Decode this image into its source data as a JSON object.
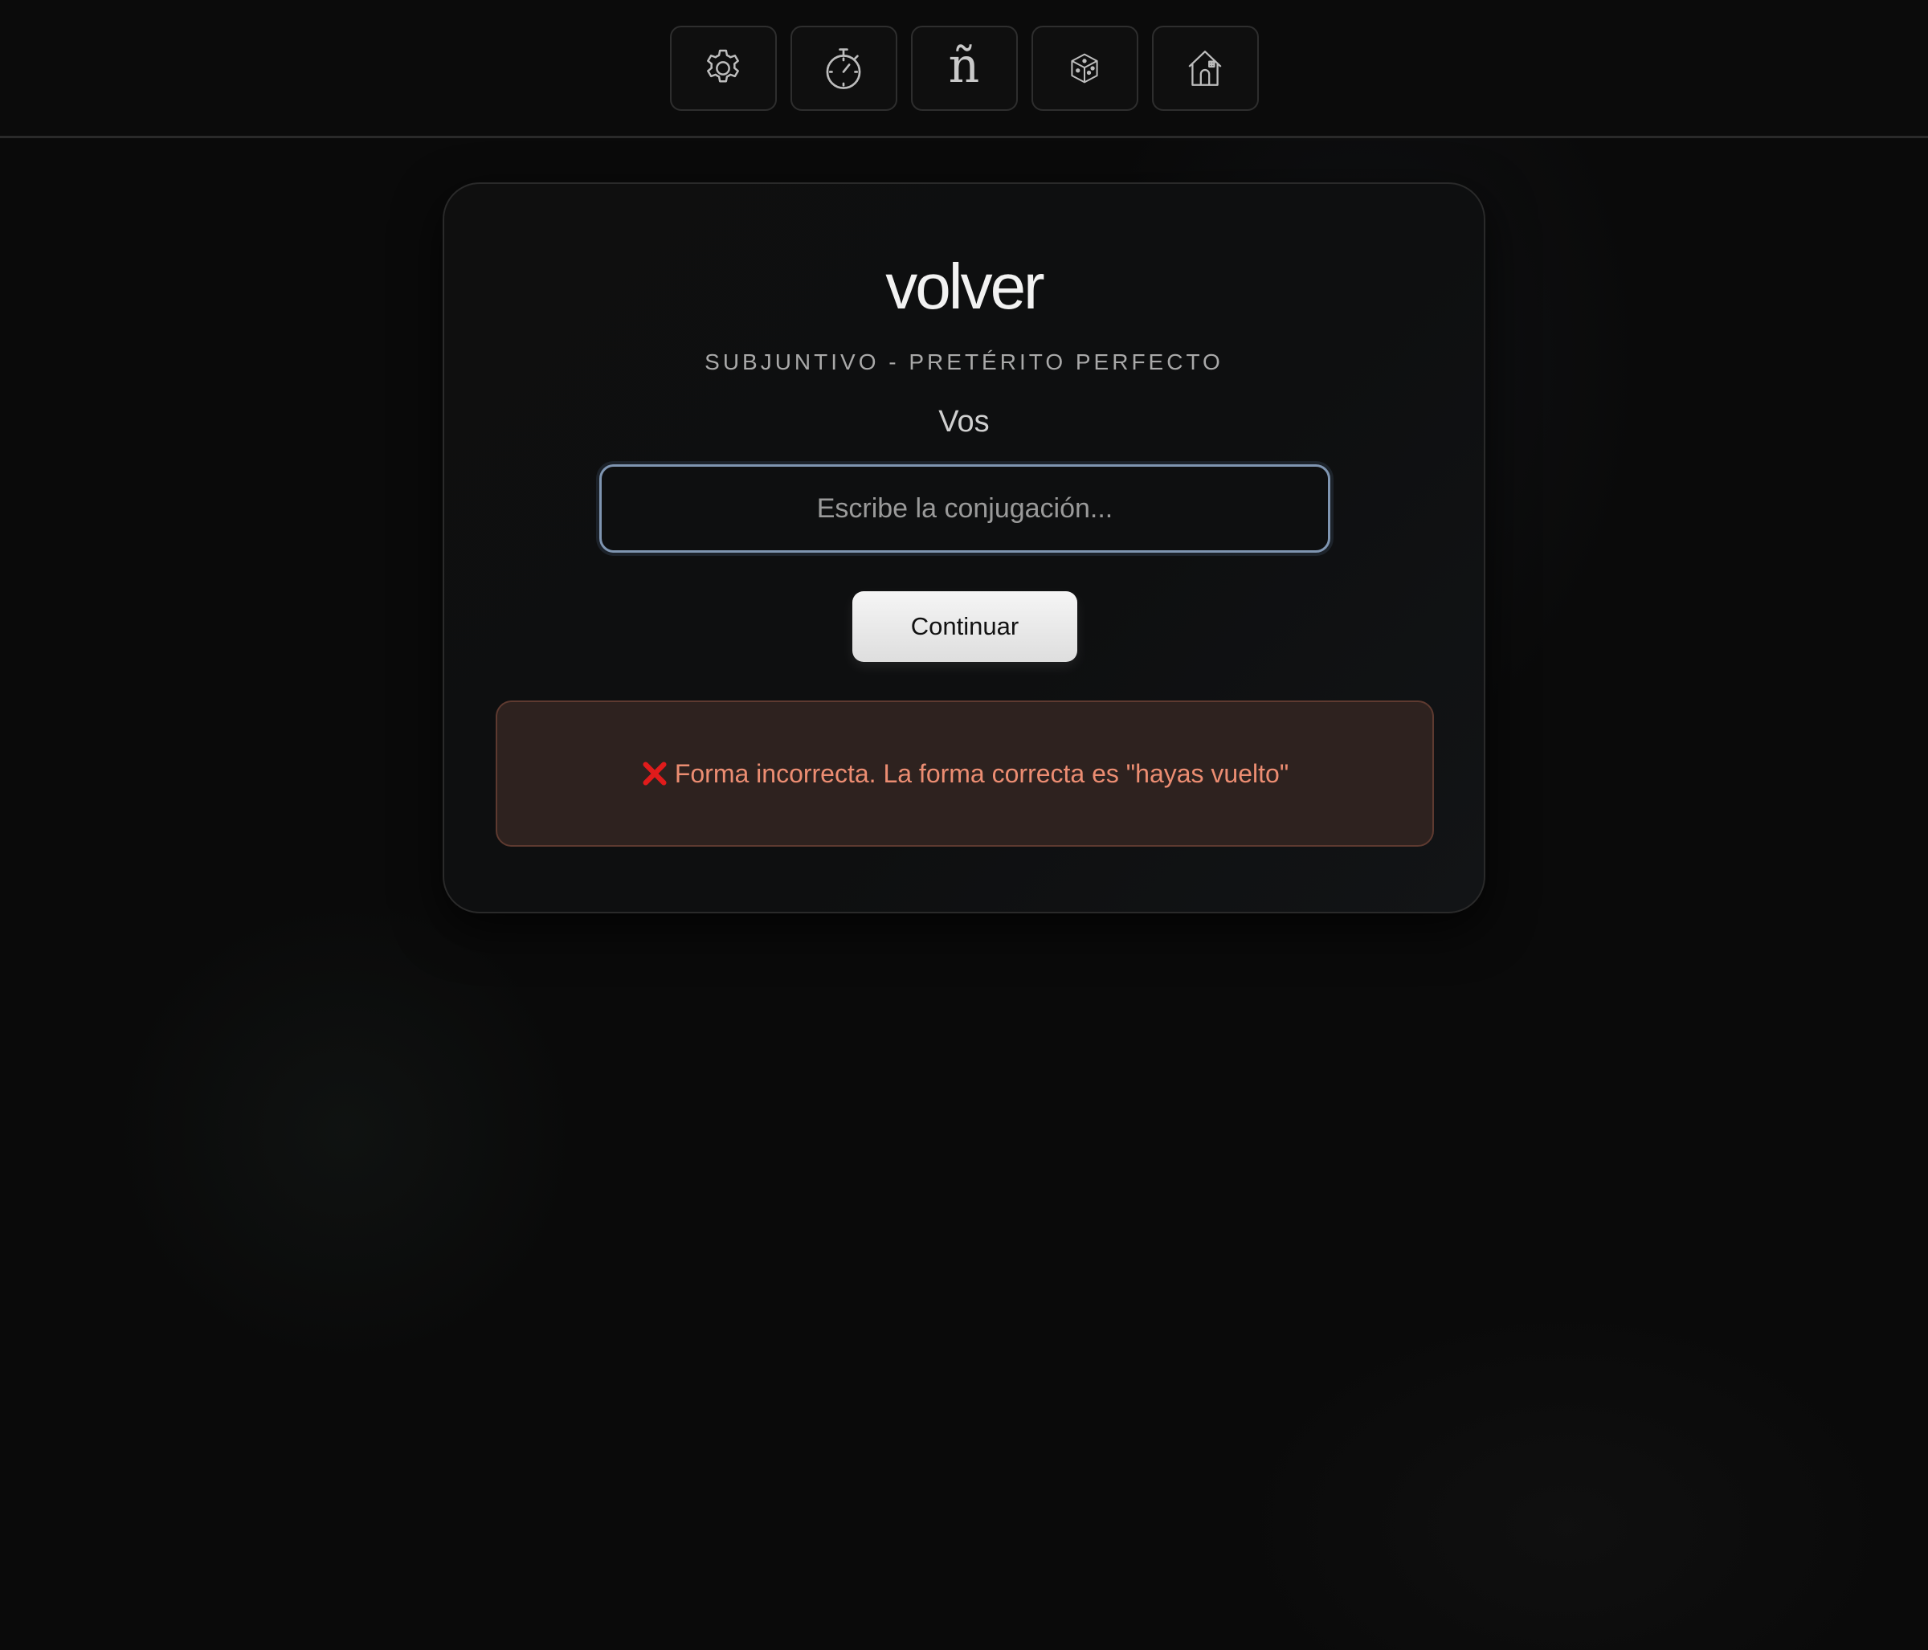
{
  "toolbar": {
    "items": [
      {
        "icon": "gear-icon",
        "label": ""
      },
      {
        "icon": "stopwatch-icon",
        "label": ""
      },
      {
        "icon": "enye-icon",
        "label": "ñ"
      },
      {
        "icon": "dice-icon",
        "label": ""
      },
      {
        "icon": "home-icon",
        "label": ""
      }
    ]
  },
  "exercise": {
    "verb": "volver",
    "tense": "SUBJUNTIVO - PRETÉRITO PERFECTO",
    "person": "Vos",
    "input_value": "",
    "input_placeholder": "Escribe la conjugación...",
    "continue_label": "Continuar"
  },
  "feedback": {
    "status": "error",
    "icon": "cross-icon",
    "message": "Forma incorrecta. La forma correcta es \"hayas vuelto\"",
    "text_color": "#ec8d72",
    "icon_color": "#e01b1b"
  },
  "colors": {
    "background": "#0a0a0a",
    "input_border": "#7f95b1",
    "feedback_bg": "#2e221f"
  }
}
